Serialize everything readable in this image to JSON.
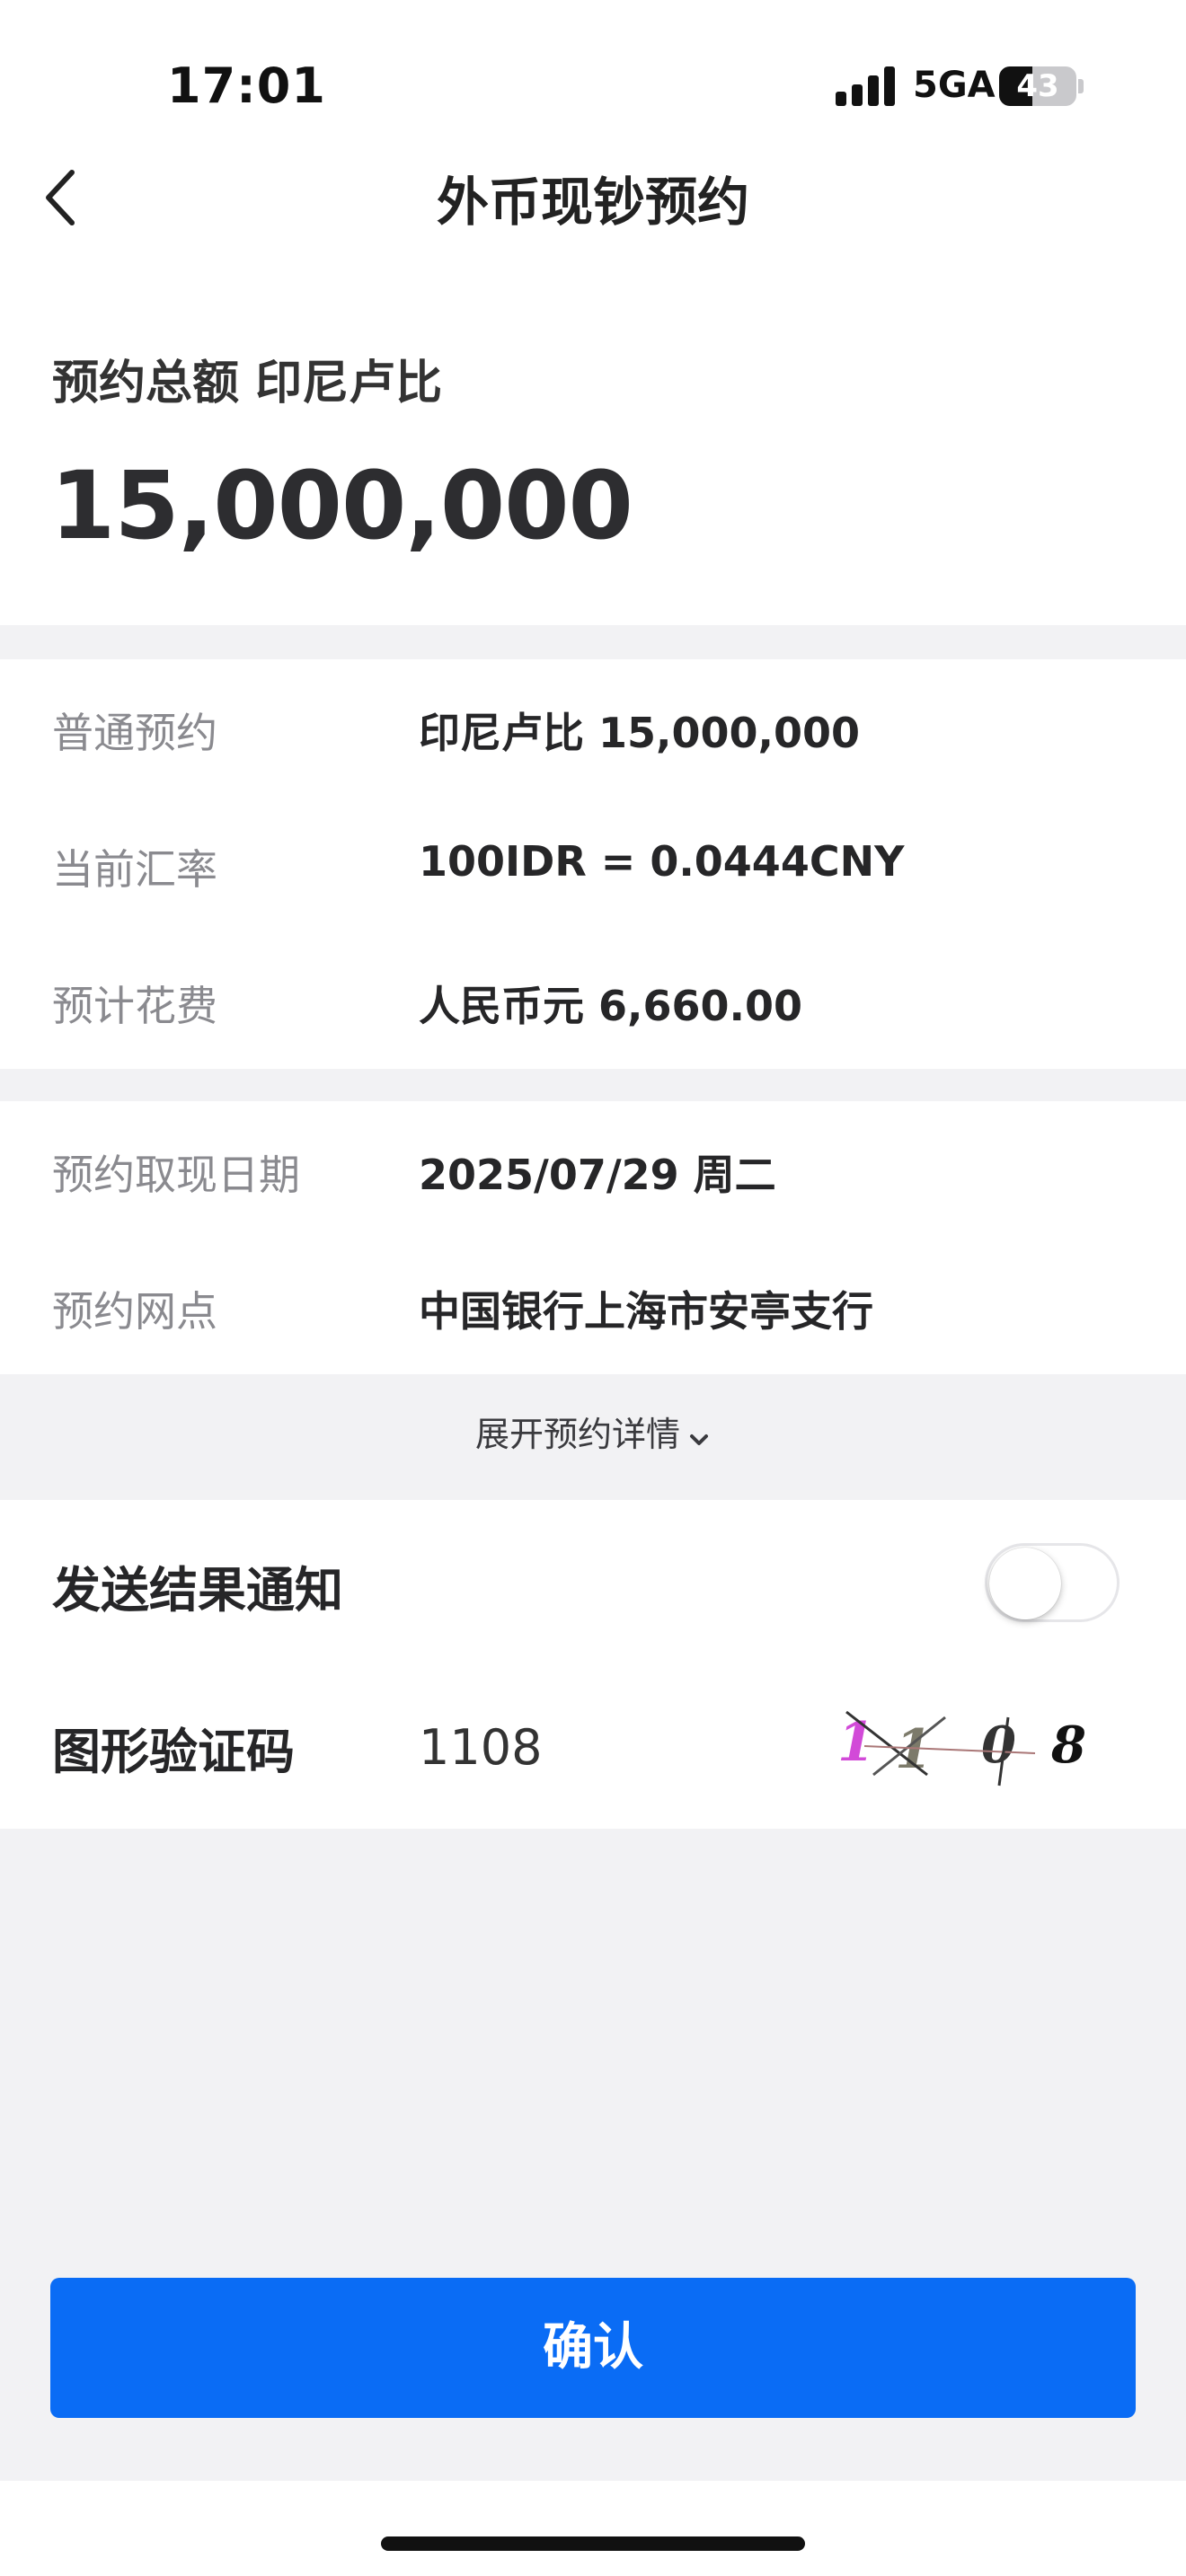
{
  "status_bar": {
    "time": "17:01",
    "network": "5GA",
    "battery": "43",
    "battery_level": 0.43
  },
  "header": {
    "title": "外币现钞预约",
    "back_icon": "chevron-left-icon"
  },
  "summary": {
    "label": "预约总额 印尼卢比",
    "amount": "15,000,000"
  },
  "details": [
    {
      "label": "普通预约",
      "value": "印尼卢比 15,000,000"
    },
    {
      "label": "当前汇率",
      "value": "100IDR = 0.0444CNY"
    },
    {
      "label": "预计花费",
      "value": "人民币元 6,660.00"
    }
  ],
  "pickup": [
    {
      "label": "预约取现日期",
      "value": "2025/07/29 周二"
    },
    {
      "label": "预约网点",
      "value": "中国银行上海市安亭支行"
    }
  ],
  "expand_link": {
    "label": "展开预约详情",
    "icon": "chevron-down-icon"
  },
  "options": {
    "notify_label": "发送结果通知",
    "notify_enabled": false,
    "captcha_label": "图形验证码",
    "captcha_value": "1108",
    "captcha_image_text": "1108"
  },
  "confirm_button": {
    "label": "确认"
  },
  "colors": {
    "primary": "#0a6cf5",
    "background": "#f2f2f4",
    "card": "#ffffff",
    "label_gray": "#8a8a8f"
  }
}
